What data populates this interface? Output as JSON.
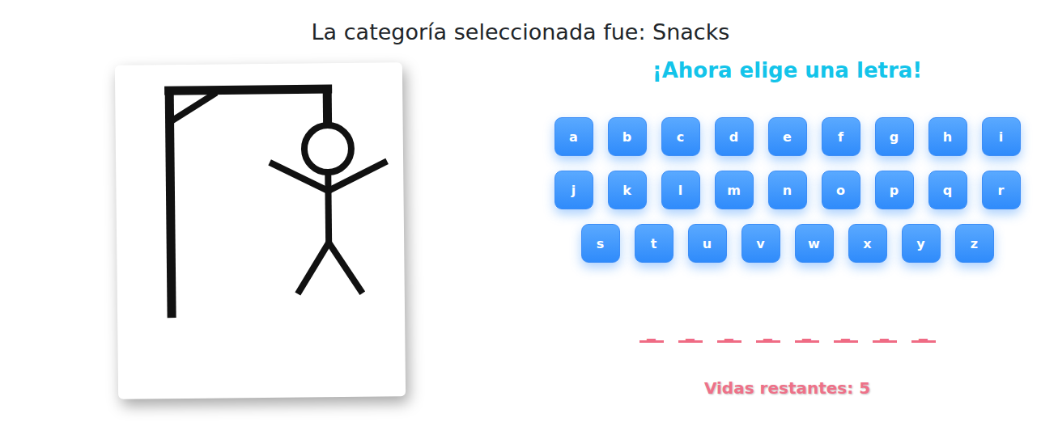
{
  "title": "La categoría seleccionada fue: Snacks",
  "hangman": {
    "parts_shown": 6
  },
  "prompt": "¡Ahora elige una letra!",
  "keyboard": {
    "rows": [
      [
        "a",
        "b",
        "c",
        "d",
        "e",
        "f",
        "g",
        "h",
        "i"
      ],
      [
        "j",
        "k",
        "l",
        "m",
        "n",
        "o",
        "p",
        "q",
        "r"
      ],
      [
        "s",
        "t",
        "u",
        "v",
        "w",
        "x",
        "y",
        "z"
      ]
    ]
  },
  "word": {
    "slots": [
      "_",
      "_",
      "_",
      "_",
      "_",
      "_",
      "_",
      "_"
    ]
  },
  "lives": "Vidas restantes: 5"
}
